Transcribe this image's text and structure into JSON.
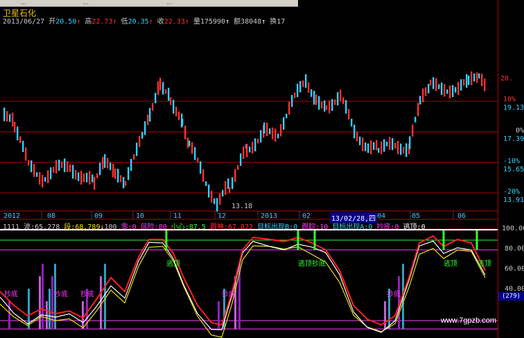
{
  "toolbar": {
    "items": [
      "...",
      "...",
      "..."
    ]
  },
  "stock": {
    "name": "卫星石化",
    "date": "2013/06/27",
    "open_label": "开",
    "open": "20.50",
    "high_label": "高",
    "high": "22.73",
    "low_label": "低",
    "low": "20.35",
    "close_label": "收",
    "close": "22.33",
    "volume_label": "量",
    "volume": "175990",
    "amount_label": "额",
    "amount": "38048",
    "turnover_label": "换",
    "turnover": "17"
  },
  "price_axis": {
    "labels": [
      "20.",
      "10%",
      "19.13",
      "0%",
      "17.39",
      "-10%",
      "15.65",
      "-20%",
      "13.91"
    ]
  },
  "low_marker": "13.18",
  "time_axis": {
    "labels": [
      "2012",
      "08",
      "09",
      "10",
      "11",
      "12",
      "2013",
      "02",
      "13/02/28,四",
      "04",
      "05",
      "06"
    ],
    "highlighted": "13/02/28,四"
  },
  "indicator_header": {
    "name": "1111",
    "wave_label": "波:",
    "wave": "65.278",
    "seg_label": "段:",
    "seg": "68.789",
    "hundred": "100",
    "zero_label": "零:",
    "zero": "0",
    "risk_label": "风险:",
    "risk": "80",
    "care_label": "小心:",
    "care": "87.5",
    "track_label": "跟神:",
    "track": "67.822",
    "target_b_label": "目标出现B:",
    "target_b": "0",
    "follow_label": "跟踪:",
    "follow": "10",
    "target_a_label": "目标出现A:",
    "target_a": "0",
    "bottom_label": "抄底:",
    "bottom": "0",
    "escape_label": "逃顶:",
    "escape": "0"
  },
  "indicator_axis": {
    "labels": [
      "100.00",
      "80.00",
      "60.00",
      "40.00"
    ]
  },
  "chart_labels": {
    "escape": "逃顶",
    "bottom": "抄底",
    "escape_bottom": "逃顶抄底"
  },
  "panel_tag": "(279)",
  "watermark": "www.7gpzb.com",
  "colors": {
    "up": "#ff3030",
    "down": "#30d0ff",
    "grid": "#b00000",
    "fast": "#ffffff",
    "slow": "#f0e000",
    "wave": "#ff2020"
  }
}
